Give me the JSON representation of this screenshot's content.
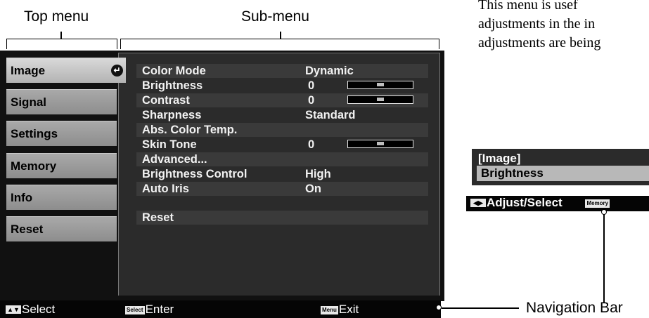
{
  "labels": {
    "top_menu": "Top menu",
    "sub_menu": "Sub-menu",
    "navigation_bar": "Navigation Bar"
  },
  "top_menu": {
    "items": [
      {
        "label": "Image",
        "active": true
      },
      {
        "label": "Signal",
        "active": false
      },
      {
        "label": "Settings",
        "active": false
      },
      {
        "label": "Memory",
        "active": false
      },
      {
        "label": "Info",
        "active": false
      },
      {
        "label": "Reset",
        "active": false
      }
    ]
  },
  "sub_menu": {
    "rows": [
      {
        "label": "Color Mode",
        "value": "Dynamic"
      },
      {
        "label": "Brightness",
        "value": "0",
        "slider_level": 0.5
      },
      {
        "label": "Contrast",
        "value": "0",
        "slider_level": 0.5
      },
      {
        "label": "Sharpness",
        "value": "Standard"
      },
      {
        "label": "Abs. Color Temp.",
        "value": ""
      },
      {
        "label": "Skin Tone",
        "value": "0",
        "slider_level": 0.5
      },
      {
        "label": "Advanced...",
        "value": ""
      },
      {
        "label": "Brightness Control",
        "value": "High"
      },
      {
        "label": "Auto Iris",
        "value": "On"
      }
    ],
    "reset_label": "Reset"
  },
  "nav_bar": {
    "select_key": "▲▼",
    "select_label": "Select",
    "enter_key": "Select",
    "enter_label": "Enter",
    "exit_key": "Menu",
    "exit_label": "Exit"
  },
  "right_panel": {
    "paragraph_lines": [
      "This  menu  is  usef",
      "adjustments in the in",
      "adjustments are being"
    ],
    "mini_title": "[Image]",
    "mini_item": "Brightness",
    "mini_nav_key": "◀▶",
    "mini_nav_label": "Adjust/Select",
    "mini_nav_key2": "Memory"
  },
  "colors": {
    "menu_background": "#111111",
    "submenu_background": "#2b2b2b",
    "tab_active": "#c8c8c8",
    "tab_inactive": "#9a9a9a"
  }
}
